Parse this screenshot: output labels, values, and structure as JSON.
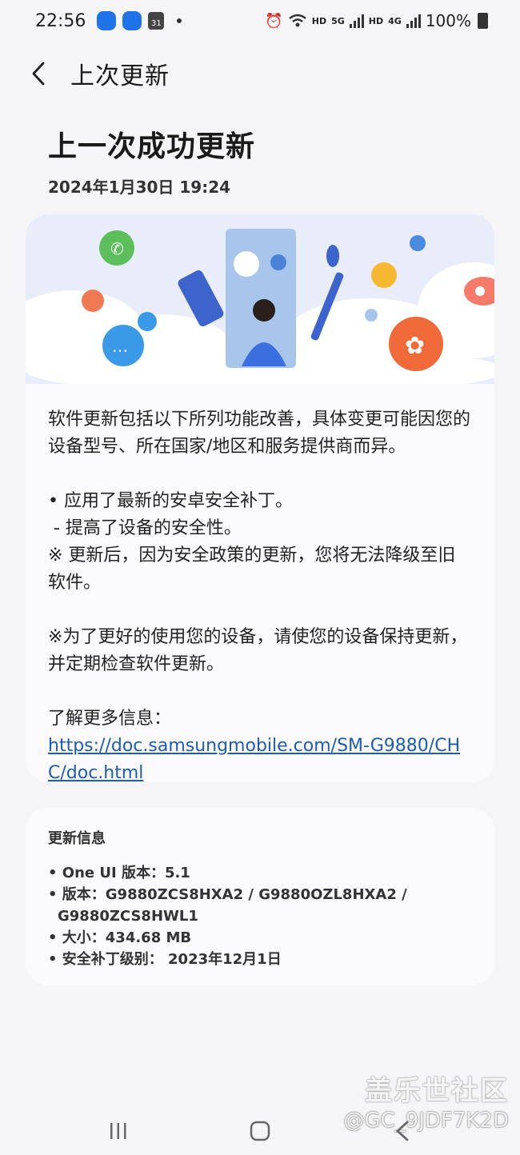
{
  "status_bar": {
    "time": "22:56",
    "calendar_day": "31",
    "hd1": "HD",
    "net1": "5G",
    "hd2": "HD",
    "net2": "4G",
    "battery": "100%"
  },
  "header": {
    "title": "上次更新"
  },
  "page": {
    "title": "上一次成功更新",
    "date": "2024年1月30日 19:24"
  },
  "description": {
    "intro": "软件更新包括以下所列功能改善，具体变更可能因您的设备型号、所在国家/地区和服务提供商而异。",
    "bullet1": "• 应用了最新的安卓安全补丁。",
    "bullet1_sub": " - 提高了设备的安全性。",
    "note": "※ 更新后，因为安全政策的更新，您将无法降级至旧软件。",
    "advice": "※为了更好的使用您的设备，请使您的设备保持更新，并定期检查软件更新。",
    "more_info_label": "了解更多信息：",
    "link": "https://doc.samsungmobile.com/SM-G9880/CHC/doc.html"
  },
  "update_info": {
    "title": "更新信息",
    "one_ui": "• One UI 版本：5.1",
    "version_line1": "• 版本：G9880ZCS8HXA2 / G9880OZL8HXA2 /",
    "version_line2": "G9880ZCS8HWL1",
    "size": "• 大小：434.68 MB",
    "security_patch": "• 安全补丁级别： 2023年12月1日"
  },
  "watermark": {
    "line1": "盖乐世社区",
    "line2": "@GC_9JDF7K2D"
  },
  "colors": {
    "link": "#1e5bb5",
    "background": "#f5f5f7",
    "card": "#fafafc"
  }
}
